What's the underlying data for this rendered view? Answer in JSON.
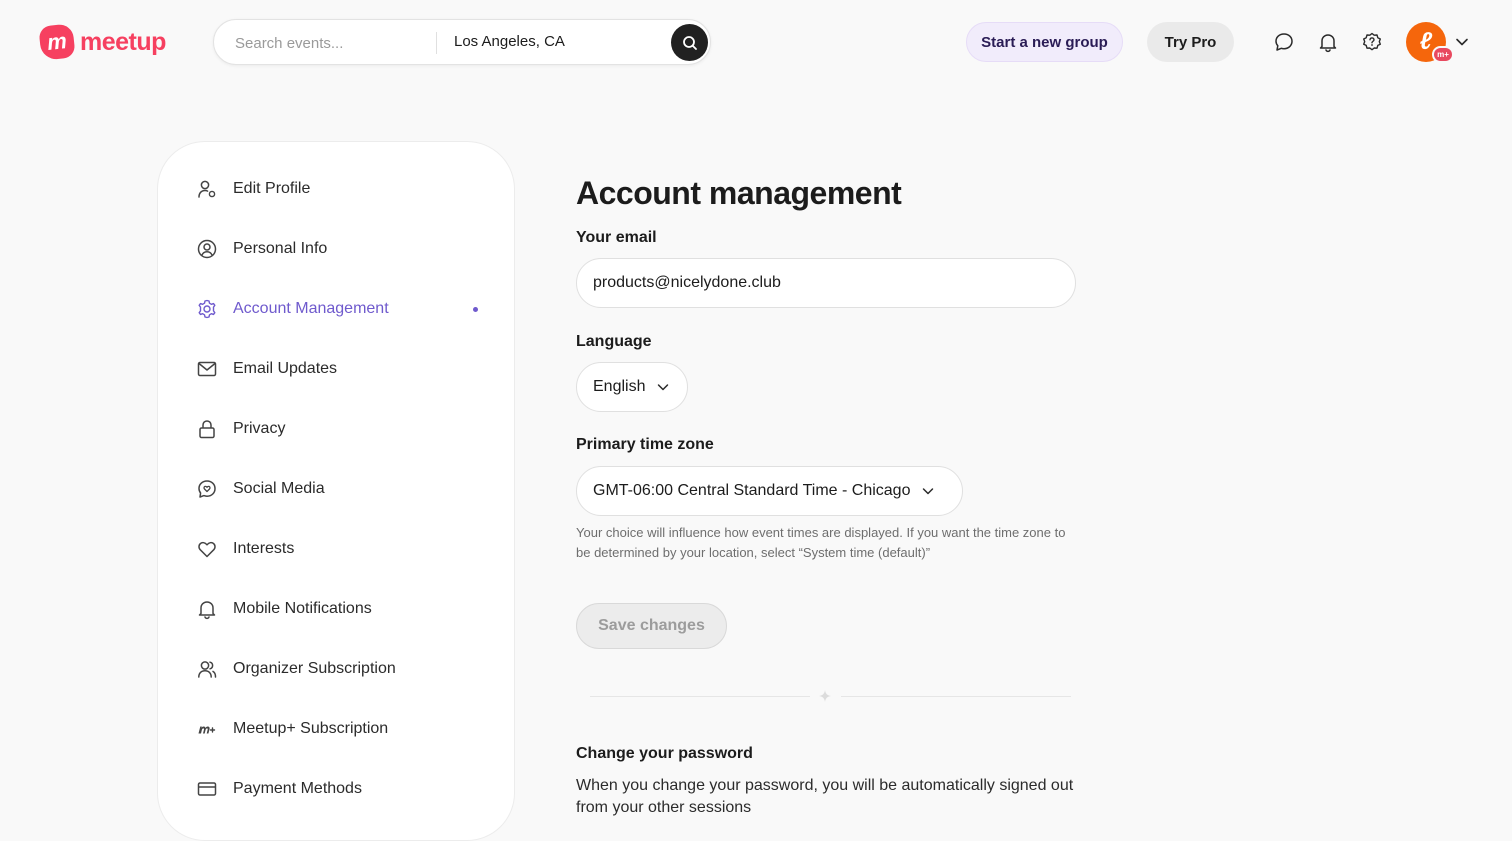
{
  "header": {
    "logo_text": "meetup",
    "logo_mark": "m",
    "search": {
      "placeholder": "Search events...",
      "location": "Los Angeles, CA"
    },
    "start_group_label": "Start a new group",
    "try_pro_label": "Try Pro",
    "icons": [
      "chat-bubble-icon",
      "bell-icon",
      "help-icon"
    ],
    "avatar_letter": "ℓ",
    "avatar_badge": "m+"
  },
  "sidebar": {
    "items": [
      {
        "label": "Edit Profile",
        "icon": "user-edit-icon",
        "active": false
      },
      {
        "label": "Personal Info",
        "icon": "user-circle-icon",
        "active": false
      },
      {
        "label": "Account Management",
        "icon": "gear-icon",
        "active": true
      },
      {
        "label": "Email Updates",
        "icon": "envelope-icon",
        "active": false
      },
      {
        "label": "Privacy",
        "icon": "lock-icon",
        "active": false
      },
      {
        "label": "Social Media",
        "icon": "chat-heart-icon",
        "active": false
      },
      {
        "label": "Interests",
        "icon": "heart-icon",
        "active": false
      },
      {
        "label": "Mobile Notifications",
        "icon": "bell-icon",
        "active": false
      },
      {
        "label": "Organizer Subscription",
        "icon": "users-icon",
        "active": false
      },
      {
        "label": "Meetup+ Subscription",
        "icon": "meetup-plus-icon",
        "active": false
      },
      {
        "label": "Payment Methods",
        "icon": "credit-card-icon",
        "active": false
      }
    ]
  },
  "main": {
    "title": "Account management",
    "email": {
      "label": "Your email",
      "value": "products@nicelydone.club"
    },
    "language": {
      "label": "Language",
      "selected": "English"
    },
    "timezone": {
      "label": "Primary time zone",
      "selected": "GMT-06:00 Central Standard Time - Chicago",
      "help": "Your choice will influence how event times are displayed. If you want the time zone to be determined by your location, select “System time (default)”"
    },
    "save_label": "Save changes",
    "password": {
      "title": "Change your password",
      "body": "When you change your password, you will be automatically signed out from your other sessions"
    }
  },
  "colors": {
    "brand": "#f64060",
    "accent": "#6f5acd",
    "avatar": "#f5660c"
  }
}
